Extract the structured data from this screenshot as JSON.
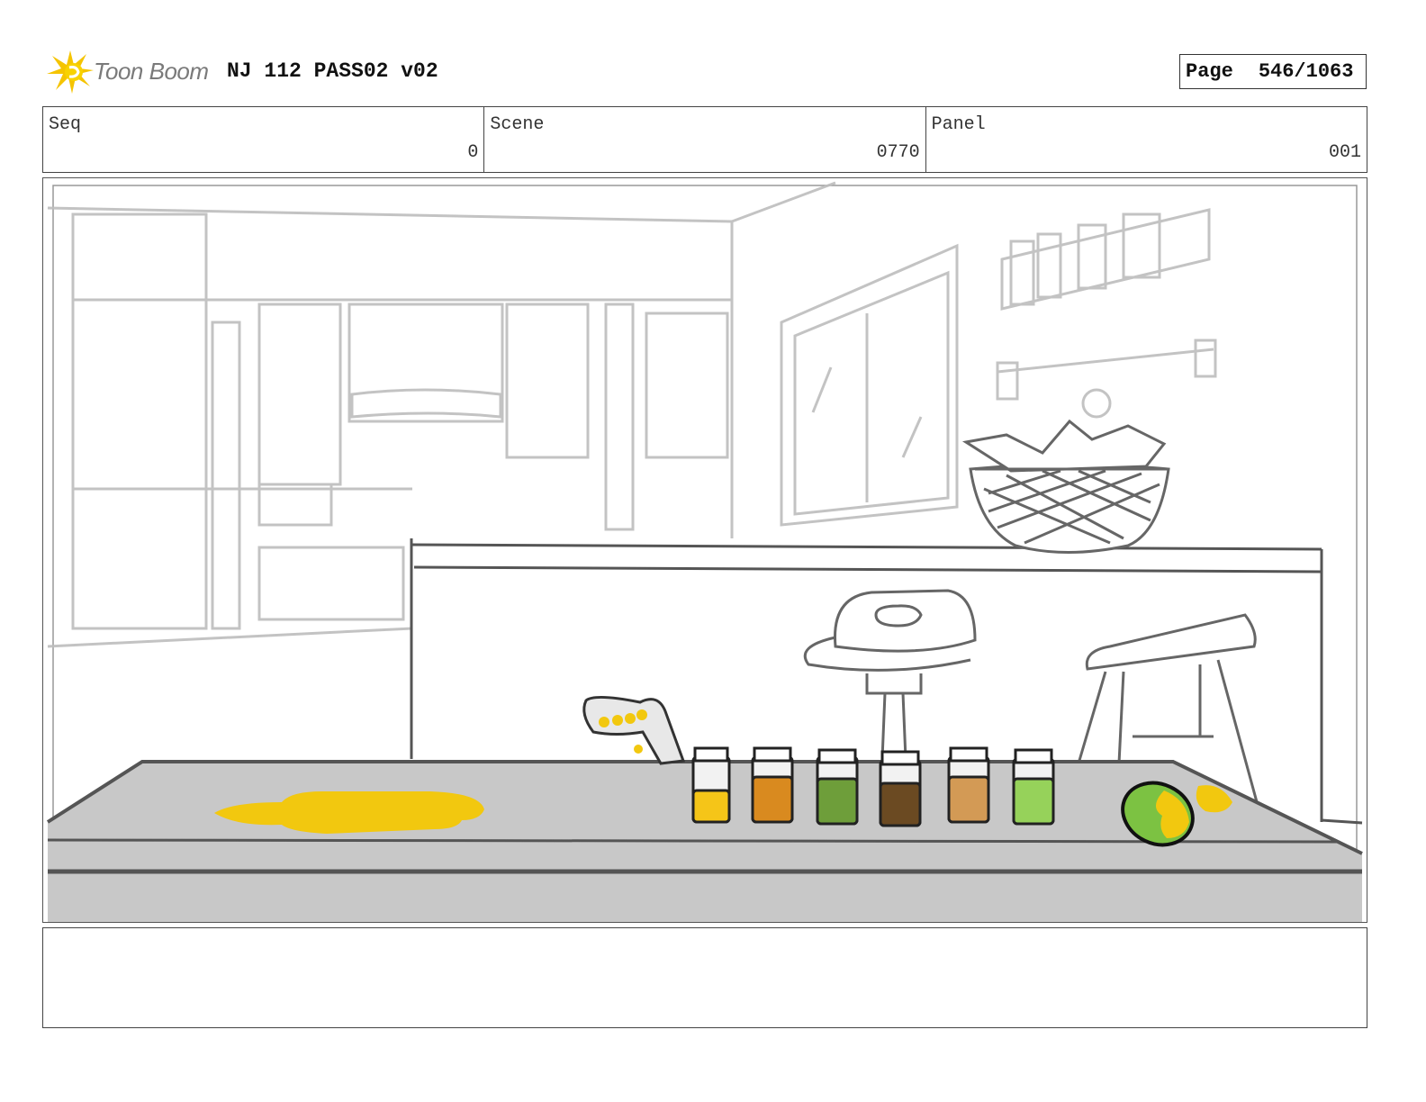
{
  "header": {
    "logo_text": "Toon Boom",
    "logo_icon": "burst-star-icon",
    "project_title": "NJ 112 PASS02 v02",
    "page_label": "Page",
    "page_value": "546/1063"
  },
  "info": {
    "seq": {
      "label": "Seq",
      "value": "0"
    },
    "scene": {
      "label": "Scene",
      "value": "0770"
    },
    "panel": {
      "label": "Panel",
      "value": "001"
    }
  },
  "colors": {
    "logo_yellow": "#f5c400",
    "spill_yellow": "#f2c80f",
    "counter_gray": "#c8c8c8",
    "jar_contents": [
      "#f5c518",
      "#d98a1f",
      "#6e9e3a",
      "#6b4a22",
      "#d39a55",
      "#96d25a"
    ],
    "mango_green": "#7cc242"
  },
  "notes": {
    "text": ""
  }
}
